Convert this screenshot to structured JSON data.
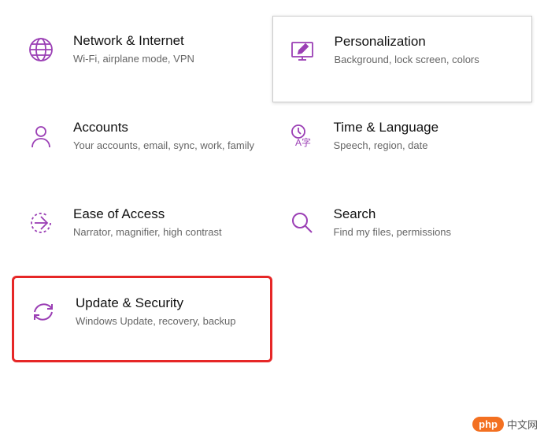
{
  "accent": "#9b3fb5",
  "tiles": {
    "network": {
      "title": "Network & Internet",
      "subtitle": "Wi-Fi, airplane mode, VPN"
    },
    "personalization": {
      "title": "Personalization",
      "subtitle": "Background, lock screen, colors"
    },
    "accounts": {
      "title": "Accounts",
      "subtitle": "Your accounts, email, sync, work, family"
    },
    "time": {
      "title": "Time & Language",
      "subtitle": "Speech, region, date"
    },
    "ease": {
      "title": "Ease of Access",
      "subtitle": "Narrator, magnifier, high contrast"
    },
    "search": {
      "title": "Search",
      "subtitle": "Find my files, permissions"
    },
    "update": {
      "title": "Update & Security",
      "subtitle": "Windows Update, recovery, backup"
    }
  },
  "watermark": {
    "badge": "php",
    "text": "中文网"
  }
}
